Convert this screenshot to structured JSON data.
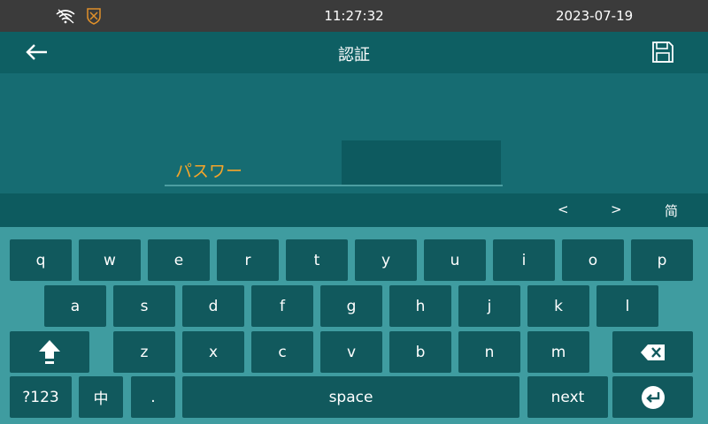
{
  "status_bar": {
    "time": "11:27:32",
    "date": "2023-07-19",
    "icons": [
      "wifi-icon",
      "shield-icon"
    ]
  },
  "app_bar": {
    "title": "認証",
    "icons": [
      "back-arrow-icon",
      "save-icon"
    ]
  },
  "form": {
    "password_label": "パスワー"
  },
  "candidate_bar": {
    "prev": "<",
    "next": ">",
    "mode": "简"
  },
  "keyboard": {
    "row1": [
      "q",
      "w",
      "e",
      "r",
      "t",
      "y",
      "u",
      "i",
      "o",
      "p"
    ],
    "row2": [
      "a",
      "s",
      "d",
      "f",
      "g",
      "h",
      "j",
      "k",
      "l"
    ],
    "row3": [
      "z",
      "x",
      "c",
      "v",
      "b",
      "n",
      "m"
    ],
    "row4": {
      "numbers": "?123",
      "lang": "中",
      "period": ".",
      "space": "space",
      "next": "next"
    },
    "icons": [
      "shift-icon",
      "backspace-icon",
      "enter-icon"
    ]
  },
  "colors": {
    "status_bar": "#3b3b3b",
    "app_bar": "#0e5f63",
    "content_bg": "#166c72",
    "label_accent": "#f4a52a",
    "keyboard_bg": "#3f9ca0",
    "key_bg": "#11595d"
  }
}
